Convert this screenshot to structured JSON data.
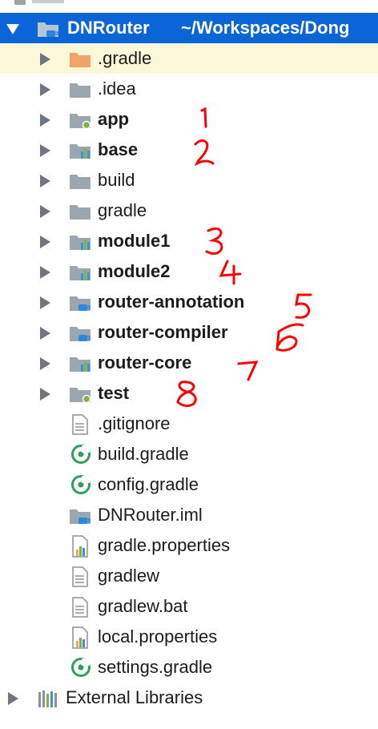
{
  "project_tree": {
    "root": {
      "name": "DNRouter",
      "path": "~/Workspaces/Dong",
      "icon": "module-folder-icon"
    },
    "items": [
      {
        "label": ".gradle",
        "icon": "orange-folder-icon",
        "bold": false
      },
      {
        "label": ".idea",
        "icon": "gray-folder-icon",
        "bold": false
      },
      {
        "label": "app",
        "icon": "app-module-folder-icon",
        "bold": true
      },
      {
        "label": "base",
        "icon": "library-module-folder-icon",
        "bold": true
      },
      {
        "label": "build",
        "icon": "gray-folder-icon",
        "bold": false
      },
      {
        "label": "gradle",
        "icon": "gray-folder-icon",
        "bold": false
      },
      {
        "label": "module1",
        "icon": "library-module-folder-icon",
        "bold": true
      },
      {
        "label": "module2",
        "icon": "library-module-folder-icon",
        "bold": true
      },
      {
        "label": "router-annotation",
        "icon": "java-module-folder-icon",
        "bold": true
      },
      {
        "label": "router-compiler",
        "icon": "java-module-folder-icon",
        "bold": true
      },
      {
        "label": "router-core",
        "icon": "library-module-folder-icon",
        "bold": true
      },
      {
        "label": "test",
        "icon": "app-module-folder-icon",
        "bold": true
      }
    ],
    "files": [
      {
        "label": ".gitignore",
        "icon": "text-file-icon"
      },
      {
        "label": "build.gradle",
        "icon": "gradle-file-icon"
      },
      {
        "label": "config.gradle",
        "icon": "gradle-file-icon"
      },
      {
        "label": "DNRouter.iml",
        "icon": "iml-file-icon"
      },
      {
        "label": "gradle.properties",
        "icon": "properties-file-icon"
      },
      {
        "label": "gradlew",
        "icon": "text-file-icon"
      },
      {
        "label": "gradlew.bat",
        "icon": "text-file-icon"
      },
      {
        "label": "local.properties",
        "icon": "properties-file-icon"
      },
      {
        "label": "settings.gradle",
        "icon": "gradle-file-icon"
      }
    ],
    "external": {
      "label": "External Libraries",
      "icon": "external-libraries-icon"
    }
  },
  "annotations": [
    "1",
    "2",
    "3",
    "4",
    "5",
    "6",
    "7",
    "8"
  ],
  "colors": {
    "selection": "#0c65d6",
    "highlight": "#fbf8d9",
    "folder_gray": "#9aa6b0",
    "folder_orange": "#f0a46a",
    "module_badge_green": "#7cb342",
    "module_badge_blue": "#3f8fdb",
    "gradle_green": "#2e9e5b",
    "annotation_red": "#ff0000"
  }
}
